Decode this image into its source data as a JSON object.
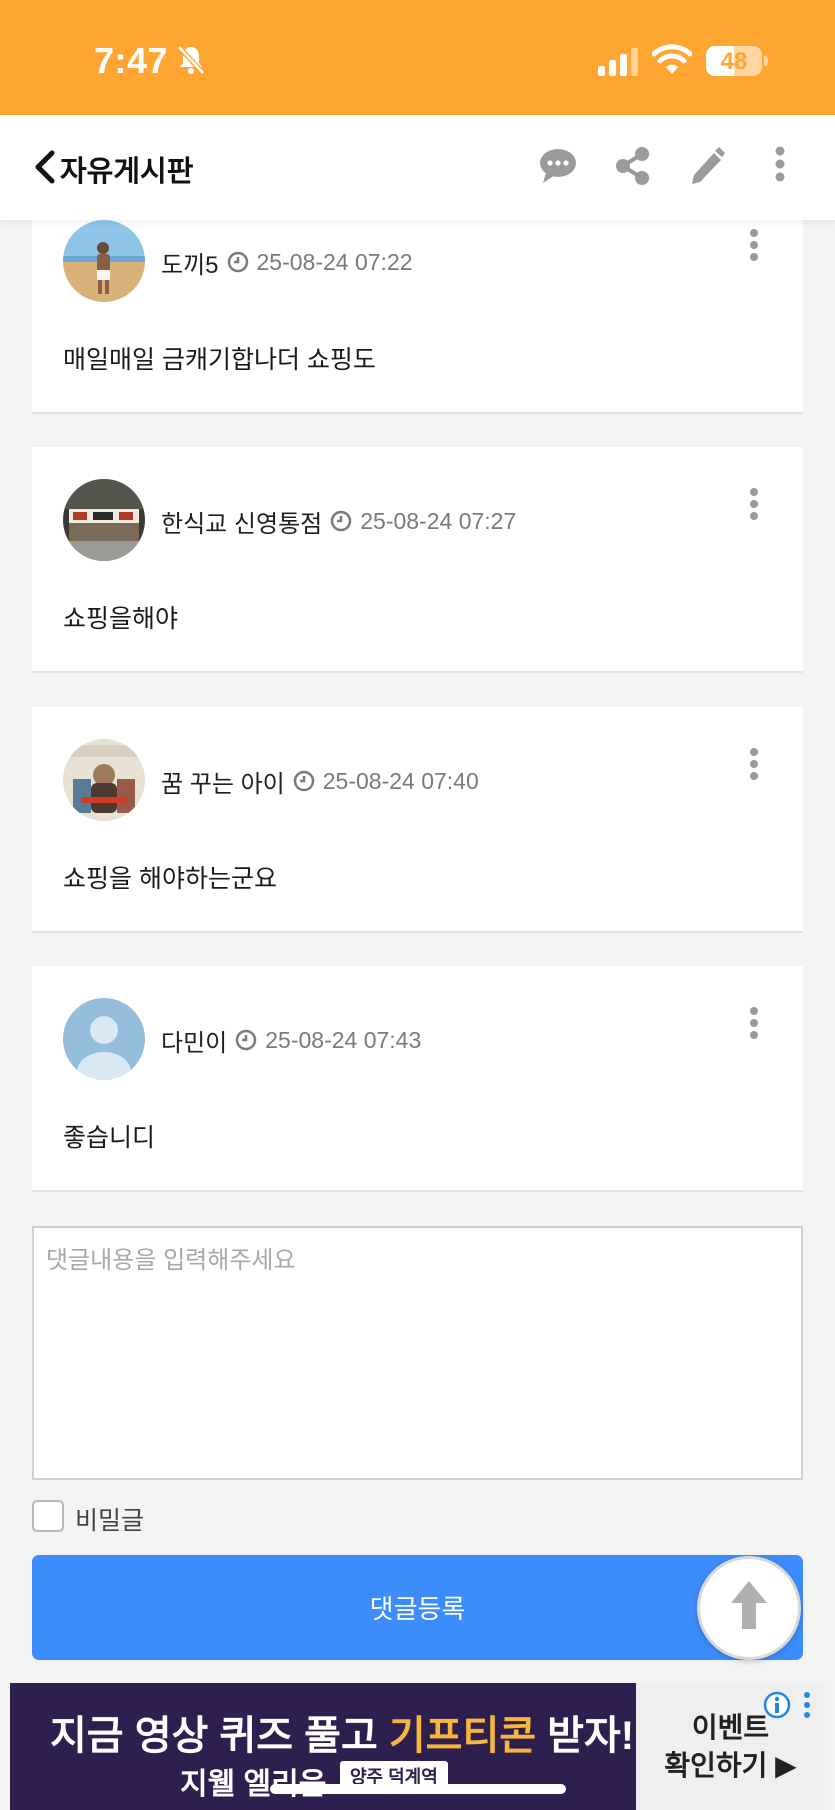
{
  "status_bar": {
    "time": "7:47",
    "battery": "48",
    "bg_color": "#ffa531"
  },
  "header": {
    "title": "자유게시판",
    "icons": [
      "back-icon",
      "comment-icon",
      "share-icon",
      "pencil-icon",
      "more-icon"
    ]
  },
  "comments": [
    {
      "author": "도끼5",
      "date": "25-08-24 07:22",
      "text": "매일매일 금캐기합나더 쇼핑도"
    },
    {
      "author": "한식교 신영통점",
      "date": "25-08-24 07:27",
      "text": "쇼핑을해야"
    },
    {
      "author": "꿈 꾸는 아이",
      "date": "25-08-24 07:40",
      "text": "쇼핑을 해야하는군요"
    },
    {
      "author": "다민이",
      "date": "25-08-24 07:43",
      "text": "좋습니디"
    }
  ],
  "comment_form": {
    "placeholder": "댓글내용을 입력해주세요",
    "value": "",
    "secret_label": "비밀글",
    "secret_checked": false,
    "submit_label": "댓글등록",
    "accent_color": "#3d8cfb"
  },
  "ad": {
    "headline_part1": "지금 영상 퀴즈 풀고 ",
    "headline_highlight": "기프티콘",
    "headline_part2": " 받자!",
    "sub": "지웰 엘리움",
    "tag": "양주 덕계역",
    "cta_line1": "이벤트",
    "cta_line2": "확인하기 ▶"
  }
}
